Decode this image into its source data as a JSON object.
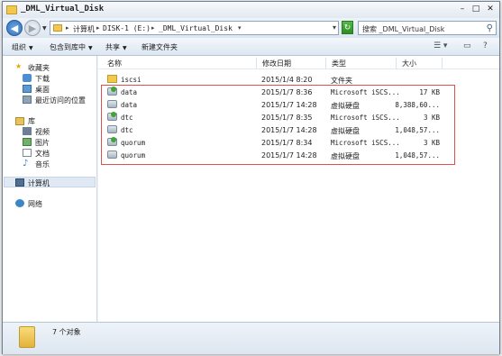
{
  "window": {
    "title": "_DML_Virtual_Disk"
  },
  "address": {
    "segments": [
      "计算机",
      "DISK-1 (E:)",
      "_DML_Virtual_Disk"
    ]
  },
  "search": {
    "text": "搜索 _DML_Virtual_Disk"
  },
  "toolbar": {
    "organize": "组织",
    "include_library": "包含到库中",
    "share": "共享",
    "new_folder": "新建文件夹"
  },
  "sidebar": {
    "favorites": "收藏夹",
    "downloads": "下载",
    "desktop": "桌面",
    "recent": "最近访问的位置",
    "libraries": "库",
    "videos": "视频",
    "pictures": "图片",
    "documents": "文档",
    "music": "音乐",
    "computer": "计算机",
    "network": "网络"
  },
  "columns": {
    "name": "名称",
    "modified": "修改日期",
    "type": "类型",
    "size": "大小"
  },
  "files": [
    {
      "name": "iscsi",
      "modified": "2015/1/4 8:20",
      "type": "文件夹",
      "size": "",
      "icon": "folder"
    },
    {
      "name": "data",
      "modified": "2015/1/7 8:36",
      "type": "Microsoft iSCS...",
      "size": "17 KB",
      "icon": "iscsi-disk"
    },
    {
      "name": "data",
      "modified": "2015/1/7 14:28",
      "type": "虚拟硬盘",
      "size": "8,388,60...",
      "icon": "disk"
    },
    {
      "name": "dtc",
      "modified": "2015/1/7 8:35",
      "type": "Microsoft iSCS...",
      "size": "3 KB",
      "icon": "iscsi-disk"
    },
    {
      "name": "dtc",
      "modified": "2015/1/7 14:28",
      "type": "虚拟硬盘",
      "size": "1,048,57...",
      "icon": "disk"
    },
    {
      "name": "quorum",
      "modified": "2015/1/7 8:34",
      "type": "Microsoft iSCS...",
      "size": "3 KB",
      "icon": "iscsi-disk"
    },
    {
      "name": "quorum",
      "modified": "2015/1/7 14:28",
      "type": "虚拟硬盘",
      "size": "1,048,57...",
      "icon": "disk"
    }
  ],
  "status": {
    "text": "7 个对象"
  }
}
